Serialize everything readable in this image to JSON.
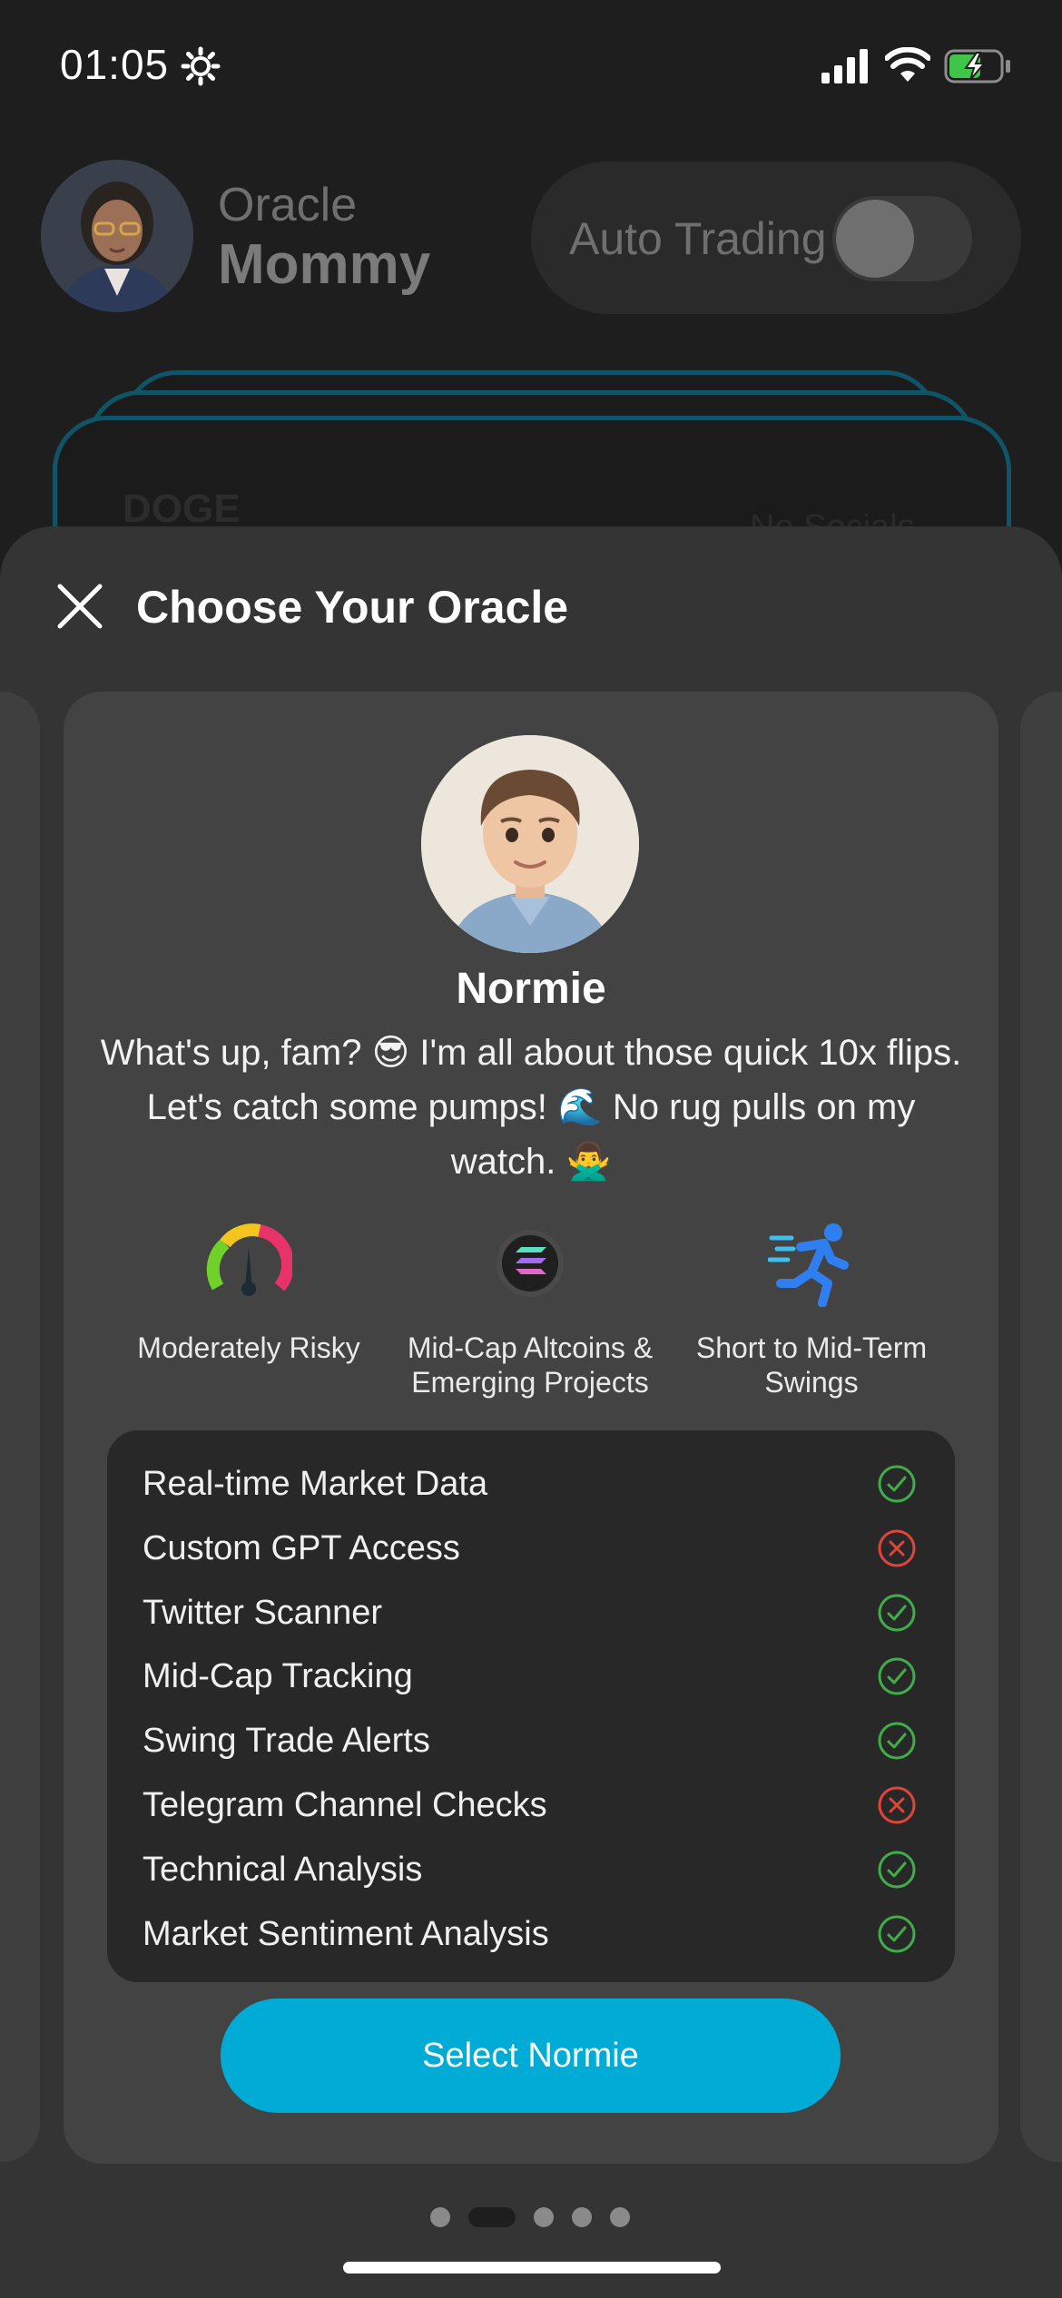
{
  "status_bar": {
    "time": "01:05"
  },
  "header": {
    "oracle_label": "Oracle",
    "oracle_name": "Mommy",
    "auto_trading_label": "Auto Trading",
    "auto_trading_enabled": false
  },
  "background_card": {
    "symbol": "DOGE",
    "socials": "No Socials"
  },
  "sheet": {
    "title": "Choose Your Oracle",
    "persona": {
      "name": "Normie",
      "description": "What's up, fam? 😎 I'm all about those quick 10x flips. Let's catch some pumps! 🌊 No rug pulls on my watch. 🙅‍♂️",
      "attributes": [
        {
          "icon": "risk-gauge-icon",
          "label": "Moderately Risky"
        },
        {
          "icon": "solana-coin-icon",
          "label": "Mid-Cap Altcoins & Emerging Projects"
        },
        {
          "icon": "running-person-icon",
          "label": "Short to Mid-Term Swings"
        }
      ],
      "features": [
        {
          "label": "Real-time Market Data",
          "included": true
        },
        {
          "label": "Custom GPT Access",
          "included": false
        },
        {
          "label": "Twitter Scanner",
          "included": true
        },
        {
          "label": "Mid-Cap Tracking",
          "included": true
        },
        {
          "label": "Swing Trade Alerts",
          "included": true
        },
        {
          "label": "Telegram Channel Checks",
          "included": false
        },
        {
          "label": "Technical Analysis",
          "included": true
        },
        {
          "label": "Market Sentiment Analysis",
          "included": true
        }
      ],
      "select_label": "Select Normie"
    },
    "pagination": {
      "total": 5,
      "active": 2
    }
  },
  "colors": {
    "accent": "#00acd6",
    "check": "#3fae49",
    "cross": "#e0443a",
    "sheet_bg": "#343434",
    "card_bg": "#434343"
  }
}
